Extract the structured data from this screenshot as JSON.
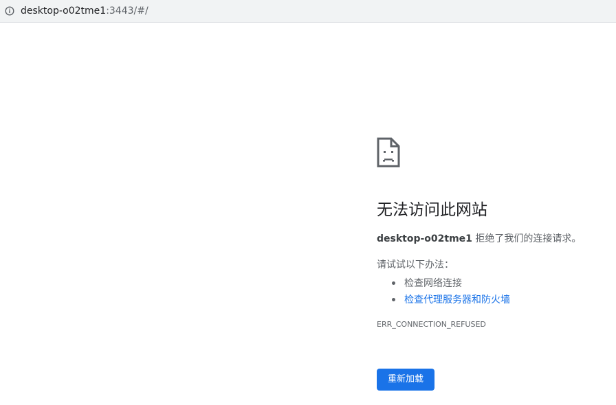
{
  "address_bar": {
    "icon": "info-icon",
    "host": "desktop-o02tme1",
    "path": ":3443/#/"
  },
  "error_page": {
    "icon": "sad-page-icon",
    "title": "无法访问此网站",
    "host": "desktop-o02tme1",
    "message": "拒绝了我们的连接请求。",
    "try_label": "请试试以下办法：",
    "suggestions": [
      {
        "label": "检查网络连接",
        "link": false
      },
      {
        "label": "检查代理服务器和防火墙",
        "link": true
      }
    ],
    "error_code": "ERR_CONNECTION_REFUSED",
    "reload_label": "重新加载"
  },
  "colors": {
    "link": "#1a73e8",
    "button_bg": "#1a73e8",
    "text_secondary": "#5f6368"
  }
}
